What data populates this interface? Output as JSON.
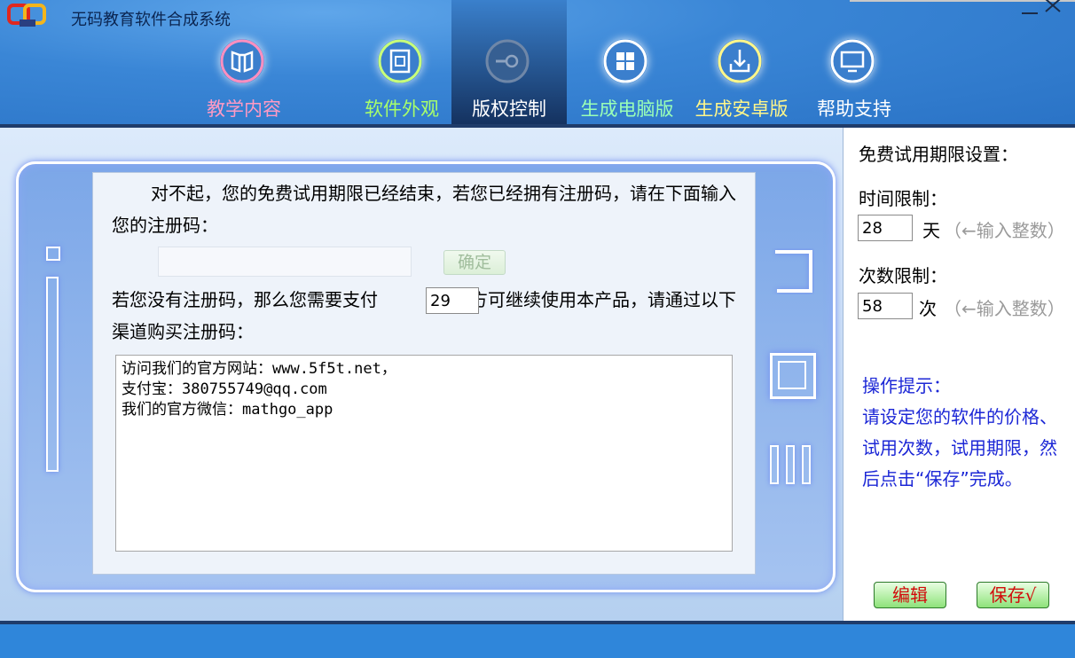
{
  "app": {
    "title": "无码教育软件合成系统",
    "window_controls": [
      "minimize",
      "close"
    ]
  },
  "nav": [
    {
      "label": "教学内容",
      "icon": "book-icon",
      "color": "#ff9ac4",
      "active": false
    },
    {
      "label": "软件外观",
      "icon": "layout-icon",
      "color": "#a8ff6a",
      "active": false
    },
    {
      "label": "版权控制",
      "icon": "key-icon",
      "color": "#ffffff",
      "active": true
    },
    {
      "label": "生成电脑版",
      "icon": "windows-icon",
      "color": "#9affb6",
      "active": false
    },
    {
      "label": "生成安卓版",
      "icon": "download-icon",
      "color": "#fff68a",
      "active": false
    },
    {
      "label": "帮助支持",
      "icon": "monitor-icon",
      "color": "#ffffff",
      "active": false
    }
  ],
  "main": {
    "message_line1": "对不起，您的免费试用期限已经结束，若您已经拥有注册码，请在下面输入您的注册码：",
    "registration_code_value": "",
    "confirm_label": "确定",
    "pay_prefix": "若您没有注册码，那么您需要支付",
    "price_value": "29",
    "pay_suffix": "元方可继续使用本产品，请通过以下渠道购买注册码：",
    "purchase_lines": [
      "访问我们的官方网站：www.5f5t.net，",
      "支付宝：380755749@qq.com",
      "我们的官方微信：mathgo_app"
    ]
  },
  "settings": {
    "title": "免费试用期限设置：",
    "time_label": "时间限制：",
    "time_value": "28",
    "time_unit": "天",
    "time_hint": "（←输入整数）",
    "count_label": "次数限制：",
    "count_value": "58",
    "count_unit": "次",
    "count_hint": "（←输入整数）",
    "tips_title": "操作提示：",
    "tips_text": "请设定您的软件的价格、试用次数，试用期限，然后点击“保存”完成。",
    "edit_label": "编辑",
    "save_label": "保存√"
  }
}
